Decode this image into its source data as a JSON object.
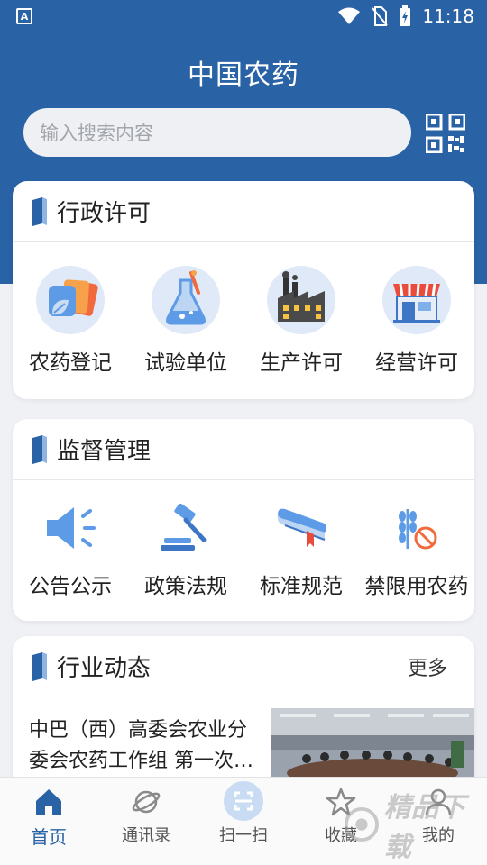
{
  "status_bar": {
    "time": "11:18",
    "app_badge": "A"
  },
  "header": {
    "title": "中国农药"
  },
  "search": {
    "placeholder": "输入搜索内容"
  },
  "colors": {
    "primary": "#2a62a6",
    "page_bg": "#f0f1f5",
    "icon_blue": "#5e9be6"
  },
  "sections": {
    "admin": {
      "title": "行政许可",
      "items": [
        {
          "label": "农药登记",
          "icon": "pesticide-registration-icon"
        },
        {
          "label": "试验单位",
          "icon": "flask-icon"
        },
        {
          "label": "生产许可",
          "icon": "factory-icon"
        },
        {
          "label": "经营许可",
          "icon": "shop-icon"
        }
      ]
    },
    "supervision": {
      "title": "监督管理",
      "items": [
        {
          "label": "公告公示",
          "icon": "megaphone-icon"
        },
        {
          "label": "政策法规",
          "icon": "gavel-icon"
        },
        {
          "label": "标准规范",
          "icon": "standards-book-icon"
        },
        {
          "label": "禁限用农药",
          "icon": "banned-pesticide-icon"
        }
      ]
    },
    "news": {
      "title": "行业动态",
      "more": "更多",
      "items": [
        {
          "text": "中巴（西）高委会农业分委会农药工作组 第一次…"
        }
      ]
    }
  },
  "tabbar": [
    {
      "label": "首页",
      "icon": "home-icon",
      "active": true
    },
    {
      "label": "通讯录",
      "icon": "planet-icon",
      "active": false
    },
    {
      "label": "扫一扫",
      "icon": "scan-icon",
      "active": false
    },
    {
      "label": "收藏",
      "icon": "star-icon",
      "active": false
    },
    {
      "label": "我的",
      "icon": "user-icon",
      "active": false
    }
  ],
  "watermark": "精品下载"
}
